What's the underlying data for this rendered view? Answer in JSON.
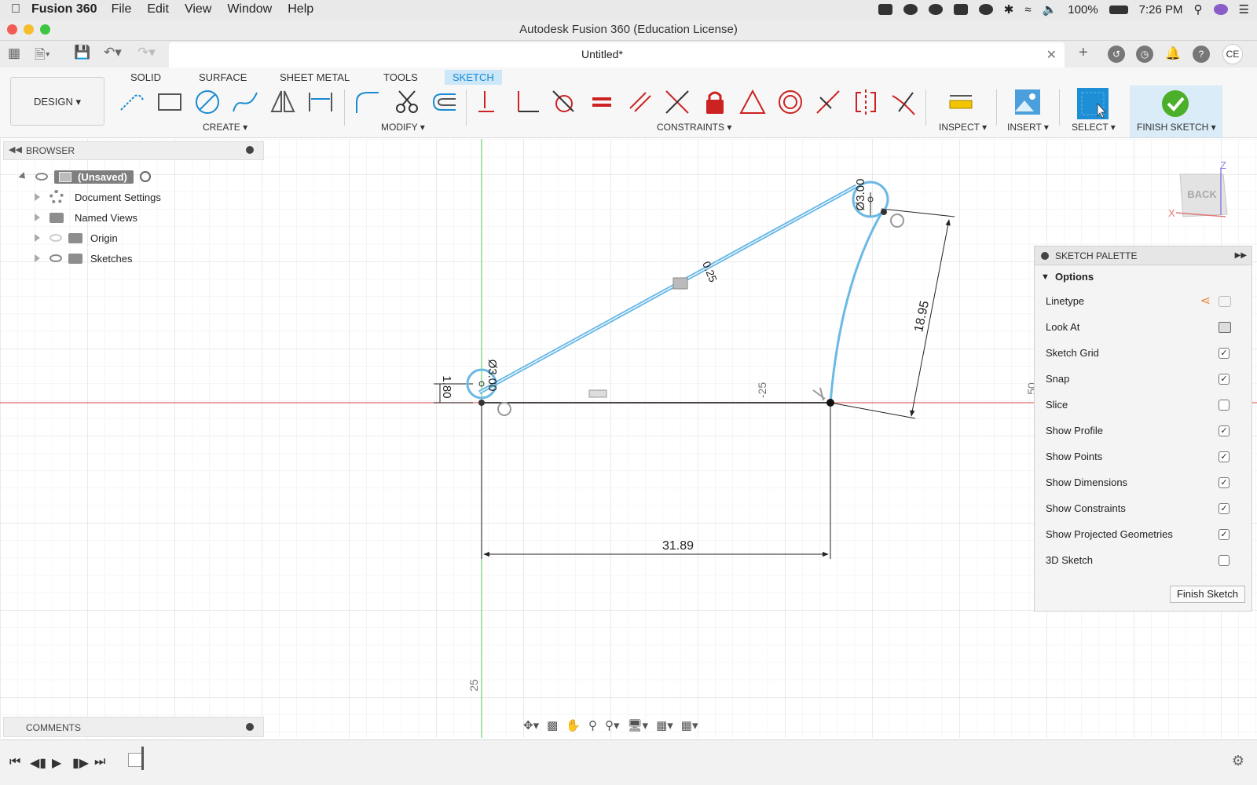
{
  "menubar": {
    "app_name": "Fusion 360",
    "menus": [
      "File",
      "Edit",
      "View",
      "Window",
      "Help"
    ],
    "battery": "100%",
    "clock": "7:26 PM"
  },
  "window": {
    "title": "Autodesk Fusion 360 (Education License)"
  },
  "tabbar": {
    "doc_title": "Untitled*",
    "user_initials": "CE"
  },
  "ribbon": {
    "workspace": "DESIGN",
    "tabs": [
      "SOLID",
      "SURFACE",
      "SHEET METAL",
      "TOOLS",
      "SKETCH"
    ],
    "active_tab": "SKETCH",
    "groups": {
      "create": "CREATE",
      "modify": "MODIFY",
      "constraints": "CONSTRAINTS",
      "inspect": "INSPECT",
      "insert": "INSERT",
      "select": "SELECT",
      "finish": "FINISH SKETCH"
    },
    "accent": "#1a8ad1",
    "finish_green": "#4caf2a"
  },
  "browser": {
    "title": "BROWSER",
    "root": "(Unsaved)",
    "items": [
      "Document Settings",
      "Named Views",
      "Origin",
      "Sketches"
    ]
  },
  "comments": {
    "title": "COMMENTS"
  },
  "viewcube": {
    "face": "BACK",
    "axis_z": "Z",
    "axis_x": "X"
  },
  "sketch": {
    "dimensions": {
      "bottom_length": "31.89",
      "right_length": "18.95",
      "top_circle_dia": "Ø3.00",
      "left_circle_dia": "Ø3.00",
      "left_height": "1.80",
      "line_offset": "0.25"
    },
    "axis_labels": {
      "x_minus": "-25",
      "y_minus": "25",
      "x_edge": "50"
    },
    "line_color": "#6bb9e6",
    "dim_color": "#222222"
  },
  "palette": {
    "title": "SKETCH PALETTE",
    "section": "Options",
    "rows": [
      {
        "label": "Linetype",
        "type": "icon"
      },
      {
        "label": "Look At",
        "type": "icon"
      },
      {
        "label": "Sketch Grid",
        "checked": "✓"
      },
      {
        "label": "Snap",
        "checked": "✓"
      },
      {
        "label": "Slice",
        "checked": ""
      },
      {
        "label": "Show Profile",
        "checked": "✓"
      },
      {
        "label": "Show Points",
        "checked": "✓"
      },
      {
        "label": "Show Dimensions",
        "checked": "✓"
      },
      {
        "label": "Show Constraints",
        "checked": "✓"
      },
      {
        "label": "Show Projected Geometries",
        "checked": "✓"
      },
      {
        "label": "3D Sketch",
        "checked": ""
      }
    ],
    "finish_button": "Finish Sketch"
  }
}
